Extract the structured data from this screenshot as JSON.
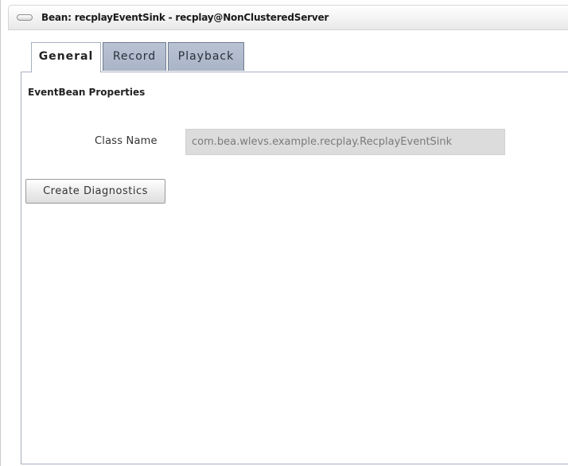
{
  "window": {
    "title": "Bean: recplayEventSink - recplay@NonClusteredServer",
    "icon": "collapse-pill-icon"
  },
  "tabs": [
    {
      "label": "General",
      "active": true
    },
    {
      "label": "Record",
      "active": false
    },
    {
      "label": "Playback",
      "active": false
    }
  ],
  "general": {
    "section_heading": "EventBean Properties",
    "class_name_label": "Class Name",
    "class_name_value": "com.bea.wlevs.example.recplay.RecplayEventSink",
    "create_diagnostics_label": "Create Diagnostics"
  },
  "colors": {
    "tab_inactive_bg": "#b3bdcf",
    "field_readonly_bg": "#dcdcdc",
    "border": "#a7b0c0"
  }
}
